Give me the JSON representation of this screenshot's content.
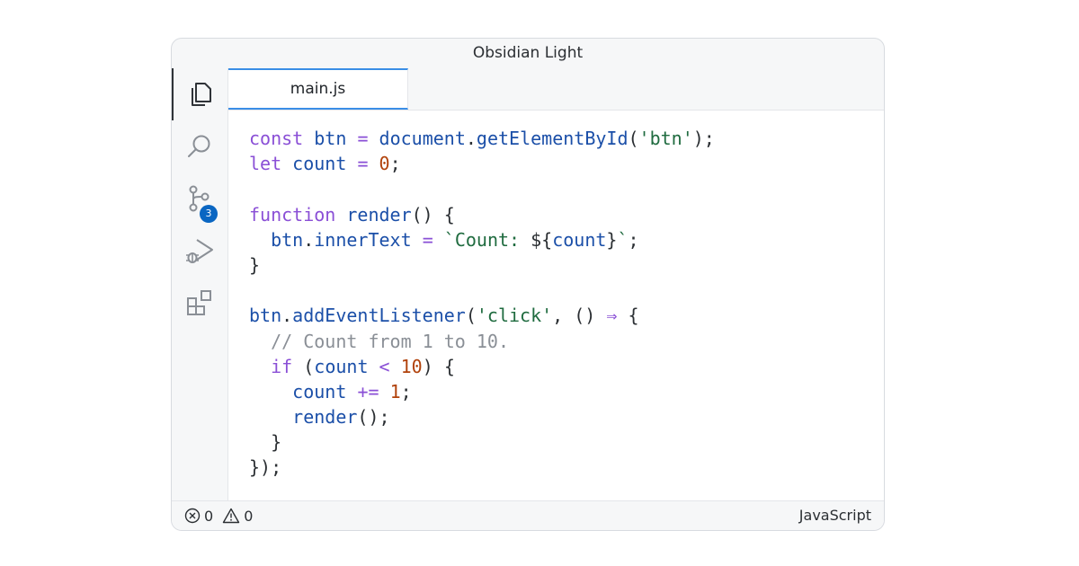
{
  "window": {
    "title": "Obsidian Light"
  },
  "activity_bar": {
    "items": [
      {
        "icon": "files-icon",
        "active": true
      },
      {
        "icon": "search-icon",
        "active": false
      },
      {
        "icon": "source-control-icon",
        "active": false,
        "badge": "3"
      },
      {
        "icon": "run-debug-icon",
        "active": false
      },
      {
        "icon": "extensions-icon",
        "active": false
      }
    ]
  },
  "tabs": [
    {
      "label": "main.js",
      "active": true
    }
  ],
  "editor": {
    "language": "JavaScript",
    "lines": [
      [
        [
          "kw",
          "const"
        ],
        [
          "pun",
          " "
        ],
        [
          "id",
          "btn"
        ],
        [
          "pun",
          " "
        ],
        [
          "op",
          "="
        ],
        [
          "pun",
          " "
        ],
        [
          "id",
          "document"
        ],
        [
          "pun",
          "."
        ],
        [
          "id",
          "getElementById"
        ],
        [
          "pun",
          "("
        ],
        [
          "str",
          "'btn'"
        ],
        [
          "pun",
          ");"
        ]
      ],
      [
        [
          "kw",
          "let"
        ],
        [
          "pun",
          " "
        ],
        [
          "id",
          "count"
        ],
        [
          "pun",
          " "
        ],
        [
          "op",
          "="
        ],
        [
          "pun",
          " "
        ],
        [
          "num",
          "0"
        ],
        [
          "pun",
          ";"
        ]
      ],
      [],
      [
        [
          "kw",
          "function"
        ],
        [
          "pun",
          " "
        ],
        [
          "id",
          "render"
        ],
        [
          "pun",
          "() {"
        ]
      ],
      [
        [
          "pun",
          "  "
        ],
        [
          "id",
          "btn"
        ],
        [
          "pun",
          "."
        ],
        [
          "id",
          "innerText"
        ],
        [
          "pun",
          " "
        ],
        [
          "op",
          "="
        ],
        [
          "pun",
          " "
        ],
        [
          "str",
          "`Count: "
        ],
        [
          "pun",
          "${"
        ],
        [
          "id",
          "count"
        ],
        [
          "pun",
          "}"
        ],
        [
          "str",
          "`"
        ],
        [
          "pun",
          ";"
        ]
      ],
      [
        [
          "pun",
          "}"
        ]
      ],
      [],
      [
        [
          "id",
          "btn"
        ],
        [
          "pun",
          "."
        ],
        [
          "id",
          "addEventListener"
        ],
        [
          "pun",
          "("
        ],
        [
          "str",
          "'click'"
        ],
        [
          "pun",
          ", () "
        ],
        [
          "op",
          "⇒"
        ],
        [
          "pun",
          " {"
        ]
      ],
      [
        [
          "pun",
          "  "
        ],
        [
          "cmt",
          "// Count from 1 to 10."
        ]
      ],
      [
        [
          "pun",
          "  "
        ],
        [
          "kw",
          "if"
        ],
        [
          "pun",
          " ("
        ],
        [
          "id",
          "count"
        ],
        [
          "pun",
          " "
        ],
        [
          "op",
          "<"
        ],
        [
          "pun",
          " "
        ],
        [
          "num",
          "10"
        ],
        [
          "pun",
          ") {"
        ]
      ],
      [
        [
          "pun",
          "    "
        ],
        [
          "id",
          "count"
        ],
        [
          "pun",
          " "
        ],
        [
          "op",
          "+="
        ],
        [
          "pun",
          " "
        ],
        [
          "num",
          "1"
        ],
        [
          "pun",
          ";"
        ]
      ],
      [
        [
          "pun",
          "    "
        ],
        [
          "id",
          "render"
        ],
        [
          "pun",
          "();"
        ]
      ],
      [
        [
          "pun",
          "  }"
        ]
      ],
      [
        [
          "pun",
          "});"
        ]
      ]
    ]
  },
  "status_bar": {
    "errors": "0",
    "warnings": "0",
    "language": "JavaScript"
  }
}
